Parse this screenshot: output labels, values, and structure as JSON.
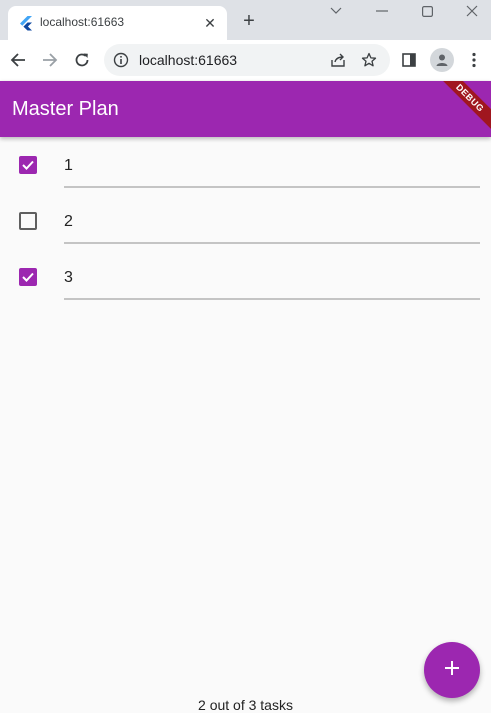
{
  "browser": {
    "tab_title": "localhost:61663",
    "url": "localhost:61663",
    "tab_close_glyph": "✕",
    "new_tab_glyph": "+"
  },
  "icons": {
    "tab_favicon": "flutter-icon",
    "back": "arrow-back-icon",
    "forward": "arrow-forward-icon",
    "reload": "reload-icon",
    "site_info": "info-icon",
    "share": "share-icon",
    "bookmark": "star-icon",
    "side_panel": "side-panel-icon",
    "profile": "profile-icon",
    "menu": "more-vert-icon",
    "add": "plus-icon"
  },
  "app": {
    "title": "Master Plan",
    "debug_banner": "DEBUG",
    "tasks": [
      {
        "label": "1",
        "done": true
      },
      {
        "label": "2",
        "done": false
      },
      {
        "label": "3",
        "done": true
      }
    ],
    "footer": "2 out of 3 tasks"
  },
  "colors": {
    "primary": "#9c27b0",
    "debug_banner": "#a0161f",
    "tab_strip": "#dee1e6",
    "background": "#fafafa"
  }
}
